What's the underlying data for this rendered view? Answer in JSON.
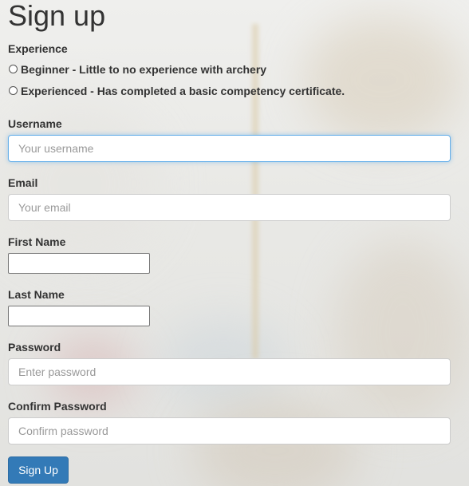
{
  "page": {
    "title": "Sign up"
  },
  "experience": {
    "label": "Experience",
    "options": [
      {
        "label": "Beginner - Little to no experience with archery",
        "selected": false
      },
      {
        "label": "Experienced - Has completed a basic competency certificate.",
        "selected": false
      }
    ]
  },
  "fields": {
    "username": {
      "label": "Username",
      "placeholder": "Your username",
      "value": ""
    },
    "email": {
      "label": "Email",
      "placeholder": "Your email",
      "value": ""
    },
    "first_name": {
      "label": "First Name",
      "value": ""
    },
    "last_name": {
      "label": "Last Name",
      "value": ""
    },
    "password": {
      "label": "Password",
      "placeholder": "Enter password",
      "value": ""
    },
    "confirm_password": {
      "label": "Confirm Password",
      "placeholder": "Confirm password",
      "value": ""
    }
  },
  "submit": {
    "label": "Sign Up"
  },
  "colors": {
    "primary": "#337ab7",
    "focus": "#66afe9",
    "text": "#333333"
  }
}
